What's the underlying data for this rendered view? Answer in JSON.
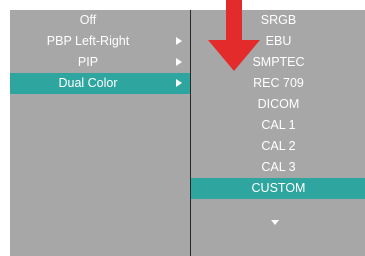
{
  "left_menu": {
    "items": [
      {
        "label": "Off",
        "has_submenu": false,
        "selected": false
      },
      {
        "label": "PBP Left-Right",
        "has_submenu": true,
        "selected": false
      },
      {
        "label": "PIP",
        "has_submenu": true,
        "selected": false
      },
      {
        "label": "Dual Color",
        "has_submenu": true,
        "selected": true
      }
    ]
  },
  "right_menu": {
    "items": [
      {
        "label": "SRGB",
        "selected": false
      },
      {
        "label": "EBU",
        "selected": false
      },
      {
        "label": "SMPTEC",
        "selected": false
      },
      {
        "label": "REC 709",
        "selected": false
      },
      {
        "label": "DICOM",
        "selected": false
      },
      {
        "label": "CAL 1",
        "selected": false
      },
      {
        "label": "CAL 2",
        "selected": false
      },
      {
        "label": "CAL 3",
        "selected": false
      },
      {
        "label": "CUSTOM",
        "selected": true
      }
    ],
    "scroll_indicator_icon": "triangle-down-icon"
  },
  "annotation": {
    "icon": "red-down-arrow-icon",
    "color": "#e32b2b"
  },
  "colors": {
    "panel": "#a7a7a7",
    "selection": "#2ea59e",
    "divider": "#2a2a2a",
    "text": "#ffffff"
  }
}
